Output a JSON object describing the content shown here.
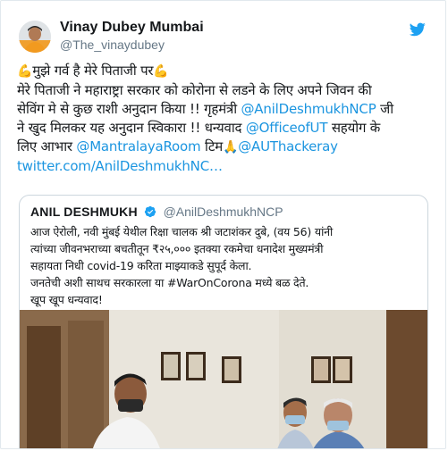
{
  "author": {
    "name": "Vinay Dubey Mumbai",
    "handle": "@The_vinaydubey",
    "avatar_icon": "profile-avatar-icon"
  },
  "brand": {
    "icon": "twitter-bird-icon",
    "color": "#1da1f2"
  },
  "tweet": {
    "emoji": "💪",
    "line1": "मुझे गर्व है मेरे पिताजी पर",
    "line2_a": "मेरे पिताजी ने महाराष्ट्रा सरकार को कोरोना से लडने के लिए अपने जिवन की",
    "line3_a": "सेविंग मे से कुछ राशी अनुदान किया !! गृहमंत्री ",
    "mention_deshmukh": "@AnilDeshmukhNCP",
    "line3_b": " जी",
    "line4_a": "ने खुद मिलकर यह अनुदान स्विकारा !! धन्यवाद ",
    "mention_office": "@OfficeofUT",
    "line4_b": " सहयोग के",
    "line5_a": "लिए आभार ",
    "mention_mantralaya": "@MantralayaRoom",
    "line5_b": "  टिम",
    "clap_emoji": "🙏",
    "mention_thackeray": "@AUThackeray",
    "link": "twitter.com/AnilDeshmukhNC…",
    "link_color": "#1b95e0"
  },
  "quote": {
    "name": "ANIL DESHMUKH",
    "handle": "@AnilDeshmukhNCP",
    "verified_icon": "verified-badge-icon",
    "line1": "आज ऐरोली, नवी मुंबई येथील रिक्षा चालक श्री जटाशंकर दुबे, (वय 56) यांनी",
    "line2": "त्यांच्या जीवनभराच्या बचतीतून ₹२५,००० इतक्या रकमेचा धनादेश मुख्यमंत्री",
    "line3": "सहायता निधी covid-19 करिता माझ्याकडे सुपूर्द केला.",
    "line4": "जनतेची अशी साथच सरकारला या #WarOnCorona मध्ये बळ देते.",
    "line5": "खूप खूप धन्यवाद!",
    "photo": "cheque-handover-photo"
  }
}
